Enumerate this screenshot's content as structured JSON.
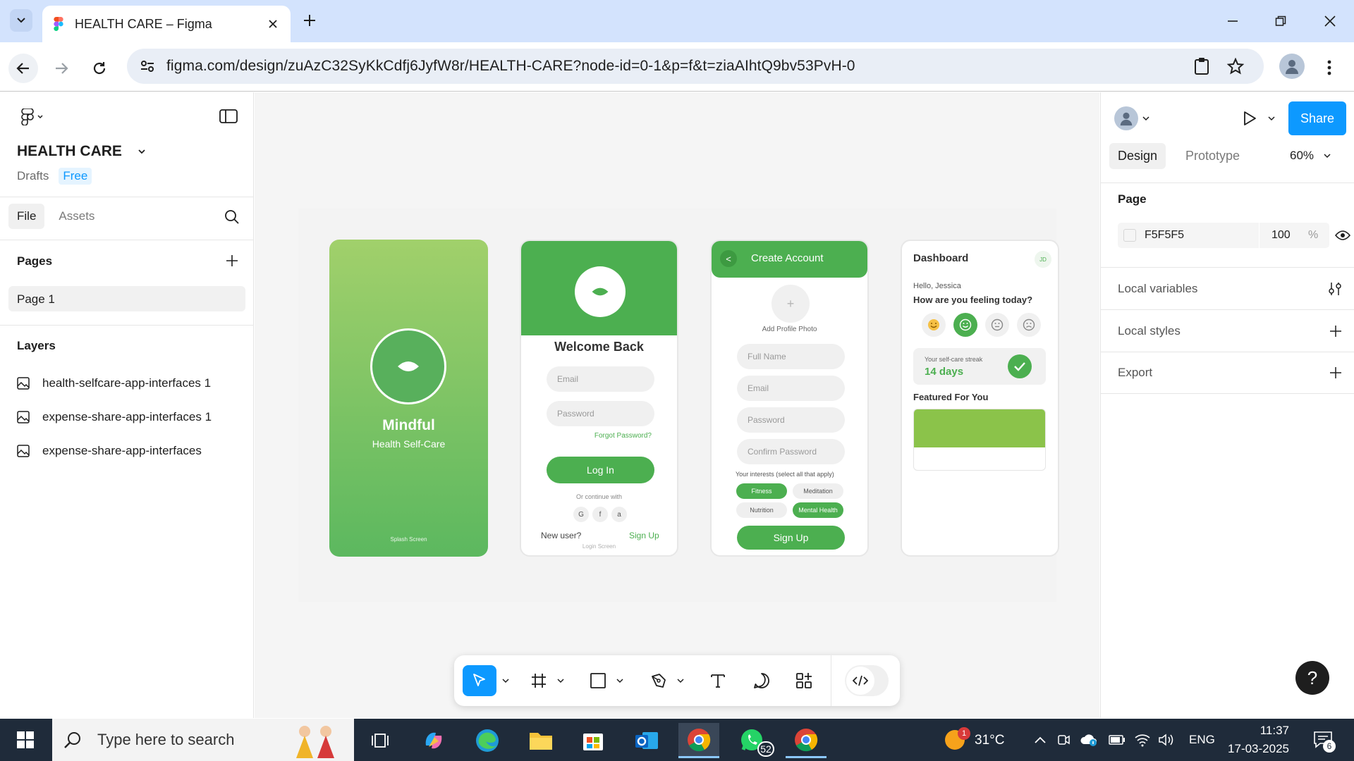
{
  "browser": {
    "tab_title": "HEALTH CARE – Figma",
    "url": "figma.com/design/zuAzC32SyKkCdfj6JyfW8r/HEALTH-CARE?node-id=0-1&p=f&t=ziaAIhtQ9bv53PvH-0"
  },
  "left_panel": {
    "file_name": "HEALTH CARE",
    "drafts_label": "Drafts",
    "plan_badge": "Free",
    "tabs": [
      "File",
      "Assets"
    ],
    "pages_heading": "Pages",
    "pages": [
      "Page 1"
    ],
    "layers_heading": "Layers",
    "layers": [
      "health-selfcare-app-interfaces 1",
      "expense-share-app-interfaces 1",
      "expense-share-app-interfaces"
    ]
  },
  "canvas": {
    "splash": {
      "app_name": "Mindful",
      "tagline": "Health Self-Care",
      "caption": "Splash Screen"
    },
    "login": {
      "heading": "Welcome Back",
      "email_placeholder": "Email",
      "password_placeholder": "Password",
      "forgot": "Forgot Password?",
      "login_button": "Log In",
      "continue_with": "Or continue with",
      "social": [
        "G",
        "f",
        "a"
      ],
      "new_user": "New user?",
      "signup_link": "Sign Up",
      "caption": "Login Screen"
    },
    "create": {
      "back": "<",
      "title": "Create Account",
      "add_photo_plus": "+",
      "add_photo": "Add Profile Photo",
      "fields": [
        "Full Name",
        "Email",
        "Password",
        "Confirm Password"
      ],
      "interests_label": "Your interests (select all that apply)",
      "interests": [
        {
          "label": "Fitness",
          "selected": true
        },
        {
          "label": "Meditation",
          "selected": false
        },
        {
          "label": "Nutrition",
          "selected": false
        },
        {
          "label": "Mental Health",
          "selected": true
        }
      ],
      "signup_button": "Sign Up"
    },
    "dashboard": {
      "title": "Dashboard",
      "avatar_initials": "JD",
      "greeting": "Hello, Jessica",
      "question": "How are you feeling today?",
      "streak_label": "Your self-care streak",
      "streak_value": "14 days",
      "featured": "Featured For You"
    },
    "colors": {
      "green": "#4caf50",
      "light_green": "#8bc34a",
      "frame_bg": "#F5F5F5"
    }
  },
  "tools": [
    "move-tool",
    "frame-tool",
    "rectangle-tool",
    "pen-tool",
    "text-tool",
    "comment-tool",
    "actions-tool",
    "dev-mode-toggle"
  ],
  "right_panel": {
    "share": "Share",
    "tabs": [
      "Design",
      "Prototype"
    ],
    "zoom": "60%",
    "page_heading": "Page",
    "bg_hex": "F5F5F5",
    "bg_opacity": "100",
    "percent_sign": "%",
    "rows": [
      "Local variables",
      "Local styles",
      "Export"
    ],
    "help": "?"
  },
  "taskbar": {
    "search_placeholder": "Type here to search",
    "whatsapp_badge": "52",
    "weather_badge": "1",
    "temperature": "31°C",
    "language": "ENG",
    "time": "11:37",
    "date": "17-03-2025",
    "notification_count": "6"
  }
}
